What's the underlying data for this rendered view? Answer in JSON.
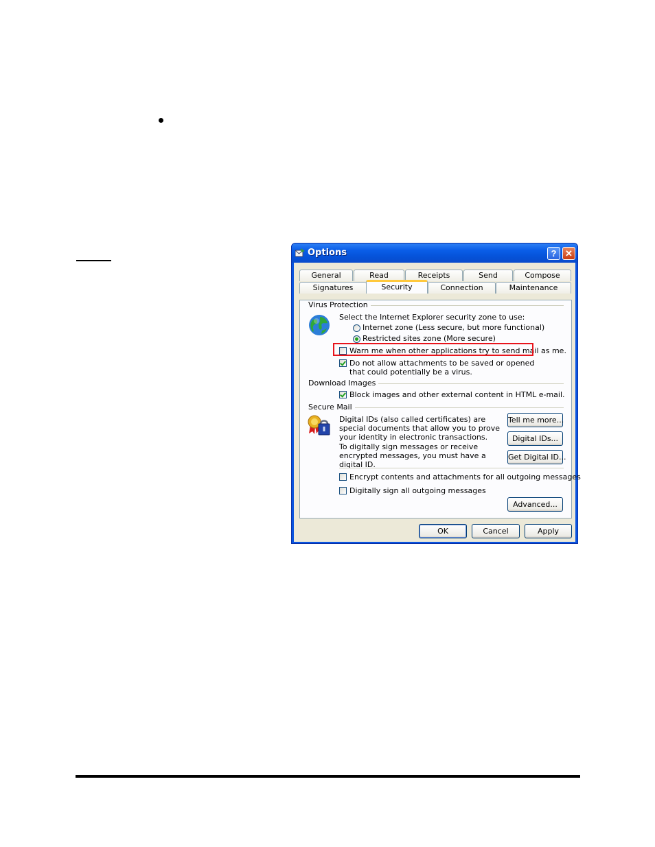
{
  "dialog": {
    "title": "Options",
    "help_label": "?",
    "close_label": "✕",
    "tabs_row_back": [
      "General",
      "Read",
      "Receipts",
      "Send",
      "Compose"
    ],
    "tabs_row_front": [
      "Signatures",
      "Security",
      "Connection",
      "Maintenance"
    ],
    "active_tab": "Security"
  },
  "virus": {
    "group_label": "Virus Protection",
    "zone_prompt": "Select the Internet Explorer security zone to use:",
    "radio_internet": "Internet zone (Less secure, but more functional)",
    "radio_restricted": "Restricted sites zone (More secure)",
    "selected_zone": "Restricted sites zone (More secure)",
    "warn_label": "Warn me when other applications try to send mail as me.",
    "warn_checked": false,
    "attach_label": "Do not allow attachments to be saved or opened that could potentially be a virus.",
    "attach_checked": true
  },
  "download": {
    "group_label": "Download Images",
    "block_label": "Block images and other external content in HTML e-mail.",
    "block_checked": true
  },
  "secure_mail": {
    "group_label": "Secure Mail",
    "description": "Digital IDs (also called certificates) are special documents that allow you to prove your identity in electronic transactions.",
    "sign_info": "To digitally sign messages or receive encrypted messages, you must have a digital ID.",
    "tell_more_button": "Tell me more...",
    "digital_ids_button": "Digital IDs...",
    "get_id_button": "Get Digital ID...",
    "encrypt_label": "Encrypt contents and attachments for all outgoing messages",
    "encrypt_checked": false,
    "sign_label": "Digitally sign all outgoing messages",
    "sign_checked": false,
    "advanced_button": "Advanced..."
  },
  "footer": {
    "ok": "OK",
    "cancel": "Cancel",
    "apply": "Apply"
  },
  "colors": {
    "highlight": "#e8141c",
    "titlebar": "#0a5ee8",
    "face": "#ece9d8"
  },
  "icons": [
    "bullet-icon",
    "options-app-icon",
    "globe-icon",
    "certificate-lock-icon"
  ]
}
